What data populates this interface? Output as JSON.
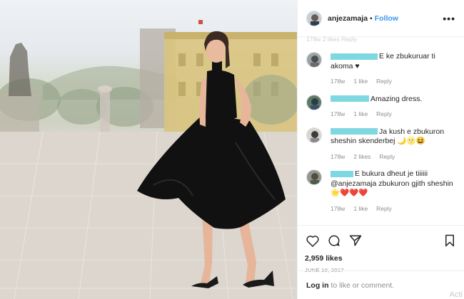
{
  "post": {
    "username": "anjezamaja",
    "separator": "•",
    "follow_label": "Follow",
    "more_label": "•••"
  },
  "faded_row": "178w   2 likes   Reply",
  "comments": [
    {
      "author_suffix": "E ke zbukuruar ti",
      "text_line2": "akoma ♥",
      "time": "178w",
      "likes": "1 like",
      "reply": "Reply"
    },
    {
      "author_suffix": "Amazing dress.",
      "time": "178w",
      "likes": "1 like",
      "reply": "Reply"
    },
    {
      "author_suffix": "Ja kush e zbukuron",
      "text_line2": "sheshin skenderbej 🌙🌝😆",
      "time": "178w",
      "likes": "2 likes",
      "reply": "Reply"
    },
    {
      "author_suffix": "E bukura dheut je tiiiiii",
      "text_line2": "@anjezamaja zbukuron gjith sheshin",
      "text_line3": "🌟❤️❤️❤️",
      "time": "178w",
      "likes": "1 like",
      "reply": "Reply"
    }
  ],
  "likes_count": "2,959 likes",
  "date": "JUNE 10, 2017",
  "login": {
    "link": "Log in",
    "rest": " to like or comment."
  },
  "watermark": "Acti",
  "icons": {
    "heart": "heart-icon",
    "comment": "comment-icon",
    "share": "share-icon",
    "bookmark": "bookmark-icon",
    "more": "more-dots-icon"
  },
  "colors": {
    "follow_blue": "#3897f0",
    "redaction": "#7fd7e2",
    "dress": "#111111"
  }
}
